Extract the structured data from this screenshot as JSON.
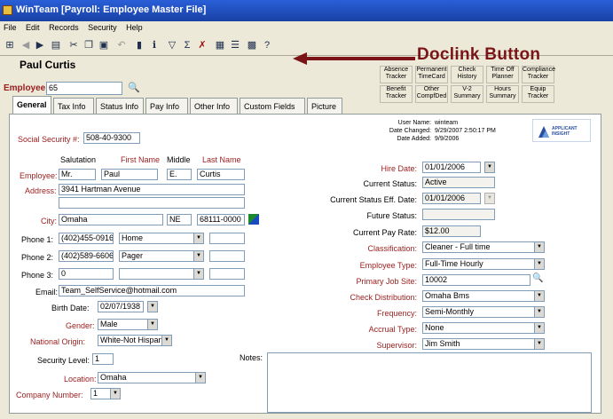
{
  "window": {
    "title": "WinTeam  [Payroll: Employee Master File]"
  },
  "menu": [
    "File",
    "Edit",
    "Records",
    "Security",
    "Help"
  ],
  "callout": "Doclink Button",
  "employee": {
    "name": "Paul Curtis",
    "number_label": "Employee #:",
    "number": "65"
  },
  "trackers": [
    [
      "Absence",
      "Tracker"
    ],
    [
      "Permanent",
      "TimeCard"
    ],
    [
      "Check",
      "History"
    ],
    [
      "Time Off",
      "Planner"
    ],
    [
      "Compliance",
      "Tracker"
    ],
    [
      "Benefit",
      "Tracker"
    ],
    [
      "Other",
      "CompfDed"
    ],
    [
      "V-2",
      "Summary"
    ],
    [
      "Hours",
      "Summary"
    ],
    [
      "Equip",
      "Tracker"
    ]
  ],
  "tabs": [
    "General",
    "Tax Info",
    "Status Info",
    "Pay Info",
    "Other Info",
    "Custom Fields",
    "Picture"
  ],
  "audit": {
    "user_name_label": "User Name:",
    "user_name": "winteam",
    "date_changed_label": "Date Changed:",
    "date_changed": "9/29/2007 2:50:17 PM",
    "date_added_label": "Date Added:",
    "date_added": "9/9/2006"
  },
  "logo": "APPLICANT INSIGHT",
  "ssn": {
    "label": "Social Security #:",
    "value": "508-40-9300"
  },
  "name_headers": {
    "salutation": "Salutation",
    "first": "First Name",
    "middle": "Middle",
    "last": "Last Name"
  },
  "name_row": {
    "label": "Employee:",
    "salutation": "Mr.",
    "first": "Paul",
    "middle": "E.",
    "last": "Curtis"
  },
  "address": {
    "label": "Address:",
    "line1": "3941 Hartman Avenue",
    "line2": ""
  },
  "city": {
    "label": "City:",
    "city": "Omaha",
    "state": "NE",
    "zip": "68111-0000"
  },
  "phones": [
    {
      "label": "Phone 1:",
      "number": "(402)455-0916",
      "type": "Home"
    },
    {
      "label": "Phone 2:",
      "number": "(402)589-6606",
      "type": "Pager"
    },
    {
      "label": "Phone 3:",
      "number": "0",
      "type": ""
    }
  ],
  "email": {
    "label": "Email:",
    "value": "Team_SelfService@hotmail.com"
  },
  "birth": {
    "label": "Birth Date:",
    "value": "02/07/1938"
  },
  "gender": {
    "label": "Gender:",
    "value": "Male"
  },
  "origin": {
    "label": "National Origin:",
    "value": "White-Not Hispanic"
  },
  "security": {
    "label": "Security Level:",
    "value": "1"
  },
  "location": {
    "label": "Location:",
    "value": "Omaha"
  },
  "company": {
    "label": "Company Number:",
    "value": "1"
  },
  "notes_label": "Notes:",
  "right": {
    "hire_date": {
      "label": "Hire Date:",
      "value": "01/01/2006"
    },
    "status": {
      "label": "Current Status:",
      "value": "Active"
    },
    "status_eff": {
      "label": "Current Status Eff. Date:",
      "value": "01/01/2006"
    },
    "future": {
      "label": "Future Status:",
      "value": ""
    },
    "pay_rate": {
      "label": "Current Pay Rate:",
      "value": "$12.00"
    },
    "classification": {
      "label": "Classification:",
      "value": "Cleaner - Full time"
    },
    "emp_type": {
      "label": "Employee Type:",
      "value": "Full-Time Hourly"
    },
    "job_site": {
      "label": "Primary Job Site:",
      "value": "10002"
    },
    "check_dist": {
      "label": "Check Distribution:",
      "value": "Omaha Bms"
    },
    "frequency": {
      "label": "Frequency:",
      "value": "Semi-Monthly"
    },
    "accrual": {
      "label": "Accrual Type:",
      "value": "None"
    },
    "supervisor": {
      "label": "Supervisor:",
      "value": "Jim Smith"
    }
  }
}
